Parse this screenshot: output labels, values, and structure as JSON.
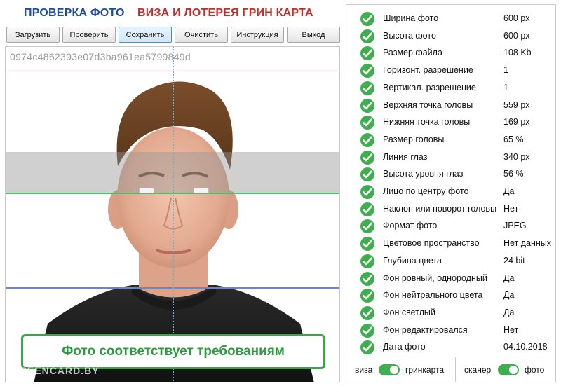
{
  "header": {
    "title_left": "ПРОВЕРКА ФОТО",
    "title_right": "ВИЗА И ЛОТЕРЕЯ ГРИН КАРТА"
  },
  "toolbar": {
    "load": "Загрузить",
    "check": "Проверить",
    "save": "Сохранить",
    "clear": "Очистить",
    "instructions": "Инструкция",
    "exit": "Выход"
  },
  "photo": {
    "hash": "0974c4862393e07d3ba961ea5799849d",
    "result": "Фото соответствует требованиям",
    "watermark": "GREENCARD.BY"
  },
  "checks": [
    {
      "label": "Ширина фото",
      "value": "600 px"
    },
    {
      "label": "Высота фото",
      "value": "600 px"
    },
    {
      "label": "Размер файла",
      "value": "108 Kb"
    },
    {
      "label": "Горизонт. разрешение",
      "value": "1"
    },
    {
      "label": "Вертикал. разрешение",
      "value": "1"
    },
    {
      "label": "Верхняя точка головы",
      "value": "559 px"
    },
    {
      "label": "Нижняя точка головы",
      "value": "169 px"
    },
    {
      "label": "Размер головы",
      "value": "65 %"
    },
    {
      "label": "Линия глаз",
      "value": "340 px"
    },
    {
      "label": "Высота уровня глаз",
      "value": "56 %"
    },
    {
      "label": "Лицо по центру фото",
      "value": "Да"
    },
    {
      "label": "Наклон или поворот головы",
      "value": "Нет"
    },
    {
      "label": "Формат фото",
      "value": "JPEG"
    },
    {
      "label": "Цветовое пространство",
      "value": "Нет данных"
    },
    {
      "label": "Глубина цвета",
      "value": "24 bit"
    },
    {
      "label": "Фон ровный, однородный",
      "value": "Да"
    },
    {
      "label": "Фон нейтрального цвета",
      "value": "Да"
    },
    {
      "label": "Фон светлый",
      "value": "Да"
    },
    {
      "label": "Фон редактировался",
      "value": "Нет"
    },
    {
      "label": "Дата фото",
      "value": "04.10.2018"
    }
  ],
  "switches": {
    "left_a": "виза",
    "left_b": "гринкарта",
    "right_a": "сканер",
    "right_b": "фото"
  },
  "colors": {
    "accent_green": "#3fae4f",
    "title_blue": "#1f4e9c",
    "title_red": "#c0302b"
  }
}
